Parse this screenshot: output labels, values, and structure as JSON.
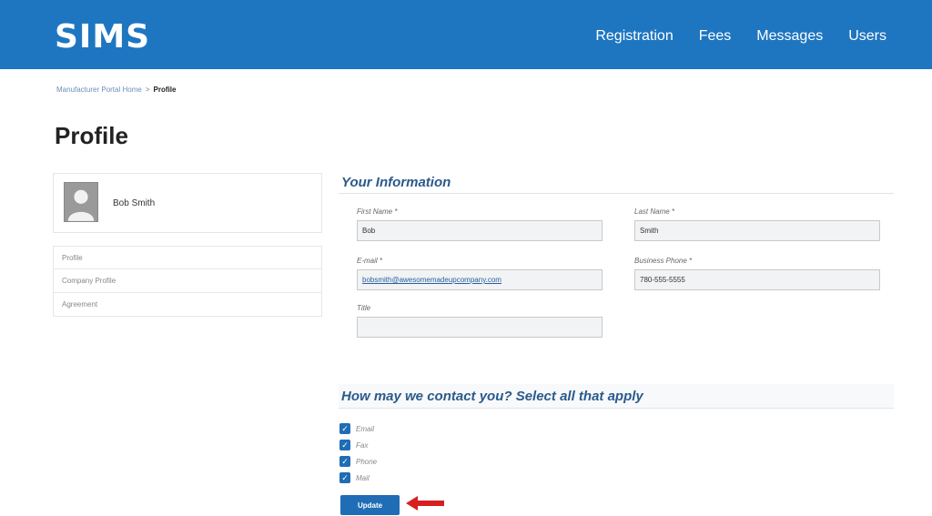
{
  "header": {
    "logo": "SIMS",
    "nav": [
      "Registration",
      "Fees",
      "Messages",
      "Users"
    ],
    "color": "#1e76c1"
  },
  "breadcrumb": {
    "home": "Manufacturer Portal Home",
    "separator": ">",
    "current": "Profile"
  },
  "page_title": "Profile",
  "user": {
    "name": "Bob Smith",
    "avatar_icon": "user-silhouette-icon"
  },
  "side_menu": [
    "Profile",
    "Company Profile",
    "Agreement"
  ],
  "your_info": {
    "title": "Your Information",
    "first_name": {
      "label": "First Name *",
      "value": "Bob"
    },
    "last_name": {
      "label": "Last Name *",
      "value": "Smith"
    },
    "email": {
      "label": "E-mail *",
      "value": "bobsmith@awesomemadeupcompany.com"
    },
    "business_phone": {
      "label": "Business Phone *",
      "value": "780-555-5555"
    },
    "title_field": {
      "label": "Title",
      "value": ""
    }
  },
  "contact": {
    "title": "How may we contact you? Select all that apply",
    "options": [
      {
        "label": "Email",
        "checked": true
      },
      {
        "label": "Fax",
        "checked": true
      },
      {
        "label": "Phone",
        "checked": true
      },
      {
        "label": "Mail",
        "checked": true
      }
    ]
  },
  "update_label": "Update",
  "accent_color": "#1f6db5",
  "annotation_arrow_color": "#d62020"
}
